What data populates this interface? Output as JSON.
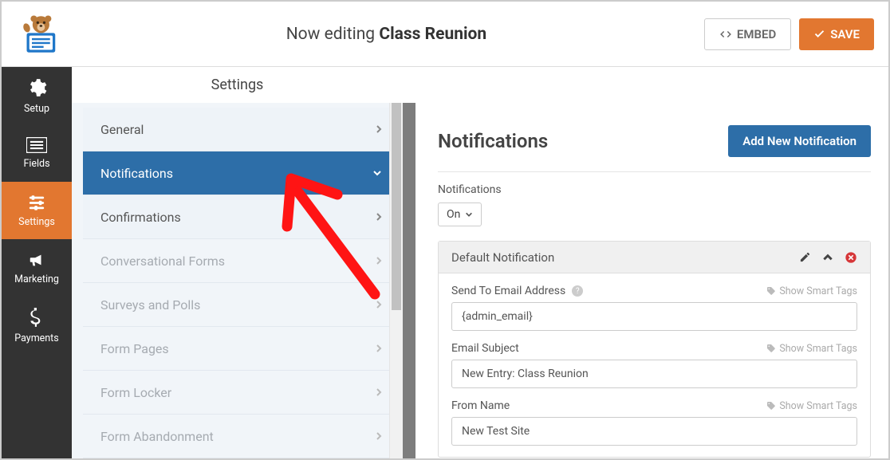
{
  "topbar": {
    "editing_prefix": "Now editing",
    "form_name": "Class Reunion",
    "embed_label": "EMBED",
    "save_label": "SAVE"
  },
  "rail": [
    {
      "label": "Setup",
      "icon": "gear"
    },
    {
      "label": "Fields",
      "icon": "list"
    },
    {
      "label": "Settings",
      "icon": "sliders",
      "active": true
    },
    {
      "label": "Marketing",
      "icon": "bullhorn"
    },
    {
      "label": "Payments",
      "icon": "dollar"
    }
  ],
  "center": {
    "header": "Settings",
    "items": [
      {
        "label": "General",
        "state": "light"
      },
      {
        "label": "Notifications",
        "state": "active"
      },
      {
        "label": "Confirmations",
        "state": "light"
      },
      {
        "label": "Conversational Forms",
        "state": "muted"
      },
      {
        "label": "Surveys and Polls",
        "state": "muted"
      },
      {
        "label": "Form Pages",
        "state": "muted"
      },
      {
        "label": "Form Locker",
        "state": "muted"
      },
      {
        "label": "Form Abandonment",
        "state": "muted"
      }
    ]
  },
  "panel": {
    "title": "Notifications",
    "add_button": "Add New Notification",
    "toggle_label": "Notifications",
    "toggle_value": "On",
    "card": {
      "title": "Default Notification",
      "smart_tags_label": "Show Smart Tags",
      "fields": {
        "send_to_label": "Send To Email Address",
        "send_to_value": "{admin_email}",
        "subject_label": "Email Subject",
        "subject_value": "New Entry: Class Reunion",
        "from_name_label": "From Name",
        "from_name_value": "New Test Site"
      }
    }
  }
}
